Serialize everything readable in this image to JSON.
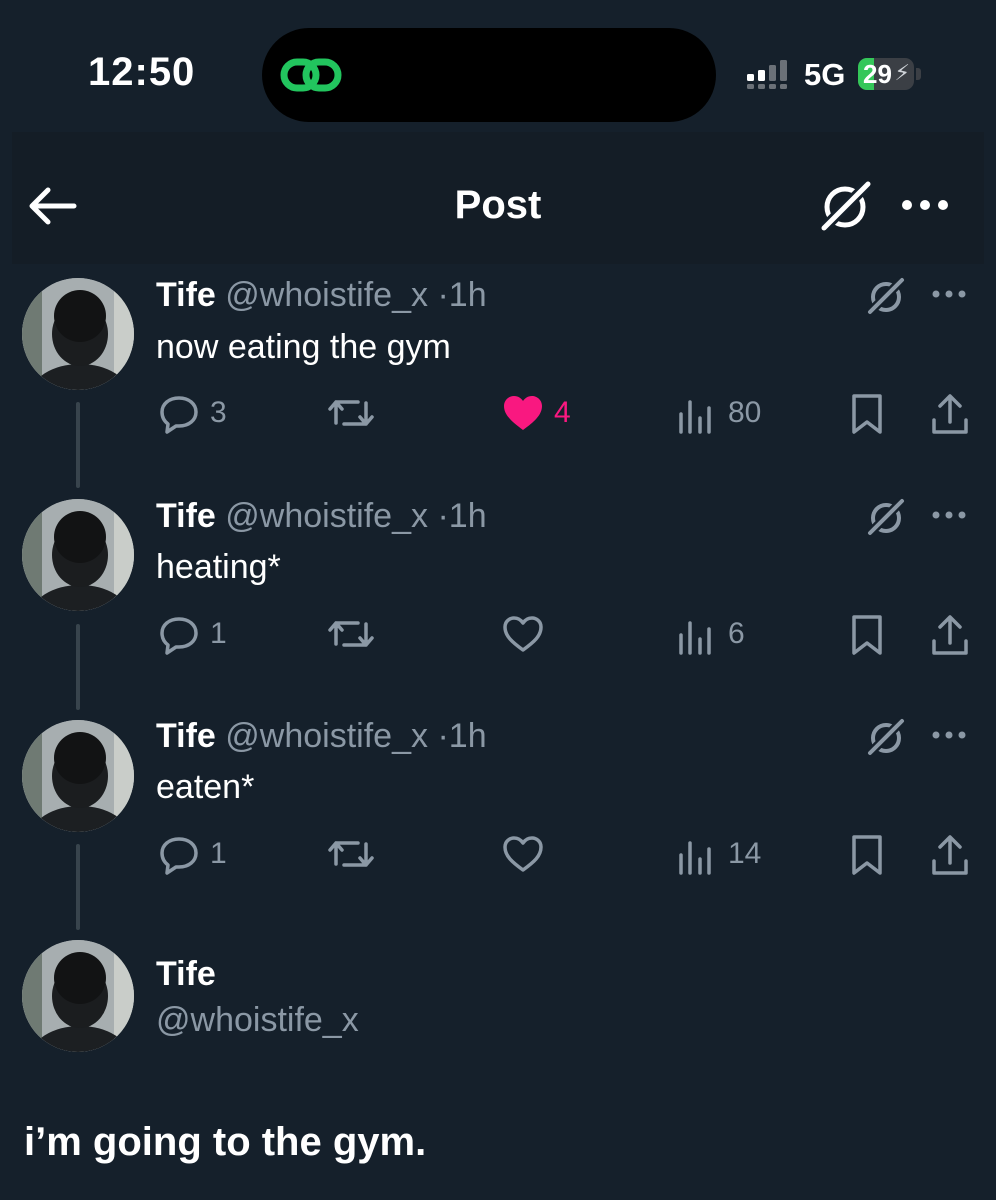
{
  "status": {
    "time": "12:50",
    "network": "5G",
    "battery": "29",
    "battery_level": 0.29
  },
  "header": {
    "title": "Post"
  },
  "replies": [
    {
      "name": "Tife",
      "handle": "@whoistife_x",
      "dot": "·",
      "ago": "1h",
      "text": "now eating the gym",
      "replies": "3",
      "likes": "4",
      "views": "80",
      "liked": true
    },
    {
      "name": "Tife",
      "handle": "@whoistife_x",
      "dot": "·",
      "ago": "1h",
      "text": "heating*",
      "replies": "1",
      "likes": "",
      "views": "6",
      "liked": false
    },
    {
      "name": "Tife",
      "handle": "@whoistife_x",
      "dot": "·",
      "ago": "1h",
      "text": "eaten*",
      "replies": "1",
      "likes": "",
      "views": "14",
      "liked": false
    }
  ],
  "main_post": {
    "name": "Tife",
    "handle": "@whoistife_x",
    "text": "i’m going to the gym."
  },
  "colors": {
    "background": "#15202b",
    "like": "#f91880",
    "muted": "#8b98a5",
    "battery": "#34c759",
    "link_icon": "#22c55e"
  }
}
